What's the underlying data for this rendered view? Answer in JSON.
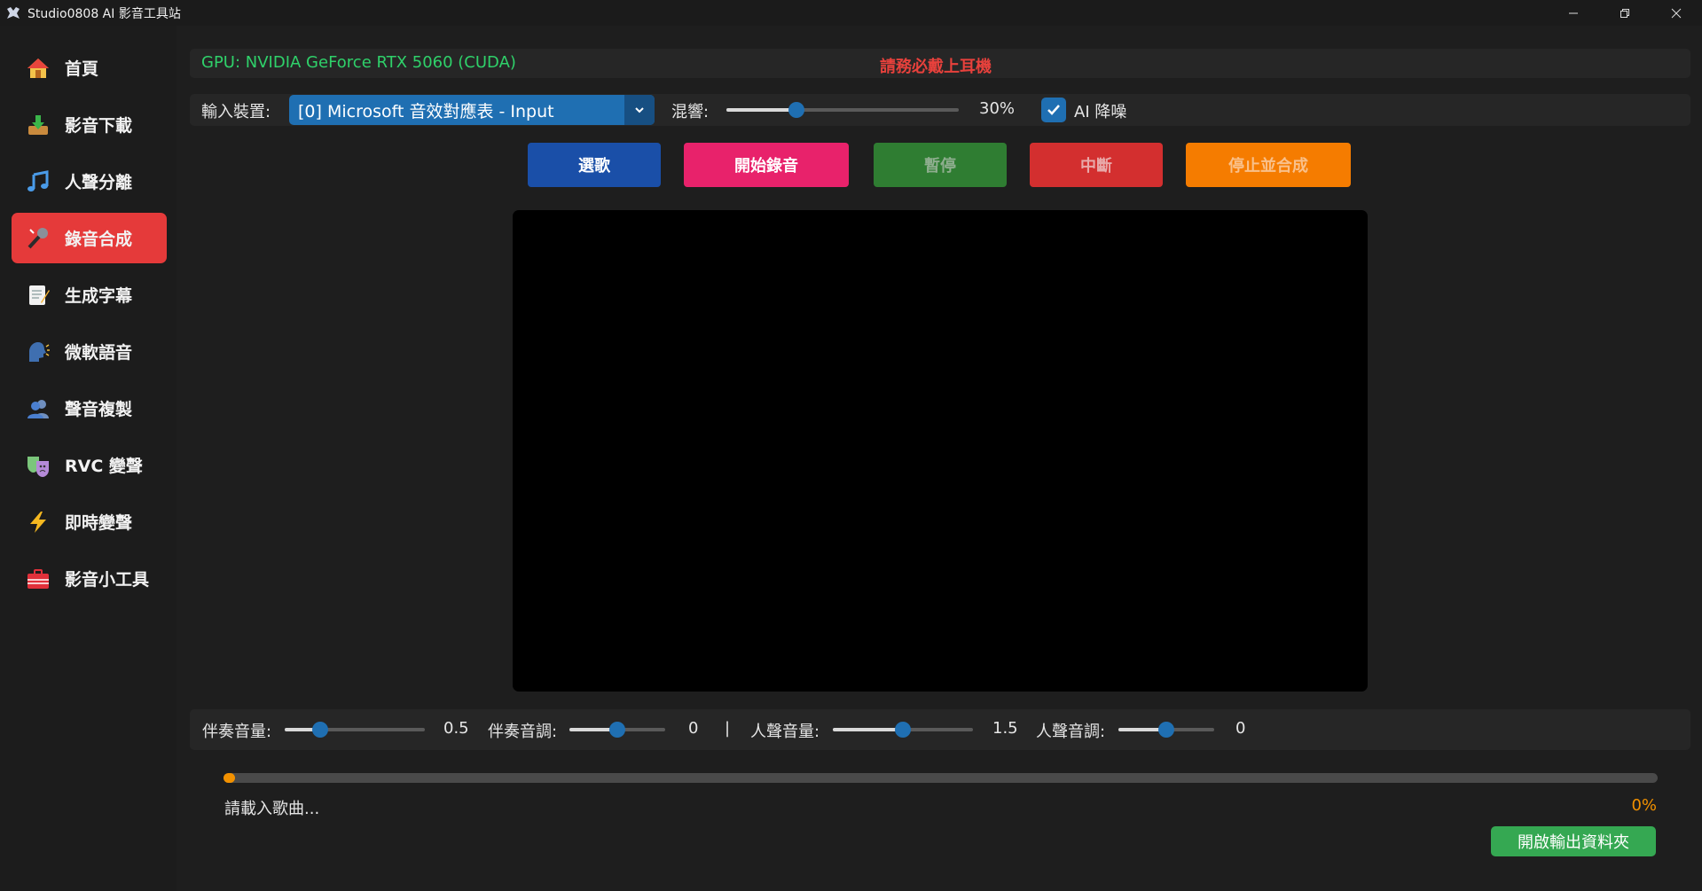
{
  "window": {
    "title": "Studio0808 AI 影音工具站",
    "icon": "app-logo-icon",
    "controls": [
      "minimize",
      "restore",
      "close"
    ]
  },
  "sidebar": {
    "items": [
      {
        "label": "首頁",
        "icon": "home-icon",
        "active": false
      },
      {
        "label": "影音下載",
        "icon": "download-icon",
        "active": false
      },
      {
        "label": "人聲分離",
        "icon": "music-note-icon",
        "active": false
      },
      {
        "label": "錄音合成",
        "icon": "microphone-icon",
        "active": true
      },
      {
        "label": "生成字幕",
        "icon": "memo-icon",
        "active": false
      },
      {
        "label": "微軟語音",
        "icon": "speaking-head-icon",
        "active": false
      },
      {
        "label": "聲音複製",
        "icon": "people-icon",
        "active": false
      },
      {
        "label": "RVC 變聲",
        "icon": "theater-masks-icon",
        "active": false
      },
      {
        "label": "即時變聲",
        "icon": "lightning-icon",
        "active": false
      },
      {
        "label": "影音小工具",
        "icon": "toolbox-icon",
        "active": false
      }
    ]
  },
  "gpu": {
    "text": "GPU: NVIDIA GeForce RTX 5060 (CUDA)",
    "warning": "請務必戴上耳機"
  },
  "input": {
    "device_label": "輸入裝置:",
    "device_value": "[0] Microsoft 音效對應表 - Input",
    "reverb_label": "混響:",
    "reverb_value": 0.3,
    "reverb_text": "30%",
    "denoise_label": "AI 降噪",
    "denoise_checked": true
  },
  "buttons": {
    "select_song": "選歌",
    "start_record": "開始錄音",
    "pause": "暫停",
    "abort": "中斷",
    "stop_merge": "停止並合成"
  },
  "mix": {
    "accomp_volume_label": "伴奏音量:",
    "accomp_volume_value": "0.5",
    "accomp_volume_level": 0.25,
    "accomp_pitch_label": "伴奏音調:",
    "accomp_pitch_value": "0",
    "accomp_pitch_level": 0.5,
    "separator": "|",
    "vocal_volume_label": "人聲音量:",
    "vocal_volume_value": "1.5",
    "vocal_volume_level": 0.5,
    "vocal_pitch_label": "人聲音調:",
    "vocal_pitch_value": "0",
    "vocal_pitch_level": 0.5
  },
  "progress": {
    "status": "請載入歌曲...",
    "percent_text": "0%",
    "value": 0
  },
  "footer": {
    "open_folder": "開啟輸出資料夾"
  },
  "colors": {
    "active_nav": "#e53a3a",
    "accent": "#1f6fb2",
    "gpu_text": "#2fd16a",
    "warning": "#e8413c",
    "btn_select": "#1a4fa8",
    "btn_record": "#e8226b",
    "btn_pause": "#2f7d32",
    "btn_abort": "#d32f2f",
    "btn_stop": "#f57c00",
    "progress": "#f29100",
    "open_folder": "#35a852"
  }
}
